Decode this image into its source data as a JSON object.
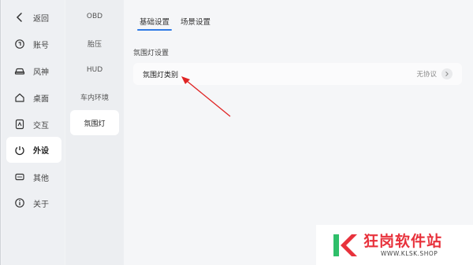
{
  "nav": {
    "items": [
      {
        "label": "返回",
        "icon": "back-chevron-icon"
      },
      {
        "label": "账号",
        "icon": "account-icon"
      },
      {
        "label": "风神",
        "icon": "car-icon"
      },
      {
        "label": "桌面",
        "icon": "home-icon"
      },
      {
        "label": "交互",
        "icon": "interaction-icon"
      },
      {
        "label": "外设",
        "icon": "peripheral-icon"
      },
      {
        "label": "其他",
        "icon": "other-icon"
      },
      {
        "label": "关于",
        "icon": "info-icon"
      }
    ],
    "active_index": 5
  },
  "submenu": {
    "items": [
      "OBD",
      "胎压",
      "HUD",
      "车内环境",
      "氛围灯"
    ],
    "active_index": 4
  },
  "tabs": {
    "items": [
      "基础设置",
      "场景设置"
    ],
    "active_index": 0
  },
  "section": {
    "title": "氛围灯设置",
    "rows": [
      {
        "label": "氛围灯类别",
        "value": "无协议"
      }
    ]
  },
  "watermark": {
    "name": "狂岗软件站",
    "url": "WWW.KLSK.SHOP"
  },
  "colors": {
    "accent": "#2f7ae5",
    "arrow": "#e02424",
    "watermark_red": "#e8323c",
    "watermark_green": "#2fbf6a"
  }
}
